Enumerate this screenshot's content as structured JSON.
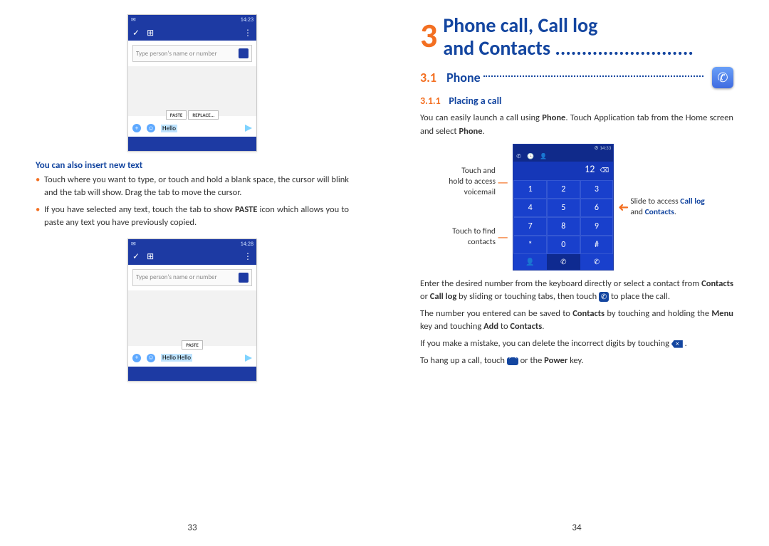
{
  "left": {
    "screenshot1": {
      "status_time": "14:23",
      "placeholder": "Type person's name or number",
      "paste": "PASTE",
      "replace": "REPLACE...",
      "selected_text": "Hello"
    },
    "heading1": "You can also insert new text",
    "bullets": [
      "Touch where you want to type, or touch and hold a blank space, the cursor will blink and the tab will show. Drag the tab to move the cursor.",
      "If you have selected any text, touch the tab to show PASTE icon which allows you to paste any text you have previously copied."
    ],
    "screenshot2": {
      "status_time": "14:28",
      "placeholder": "Type person's name or number",
      "paste": "PASTE",
      "text": "Hello Hello"
    },
    "page_num": "33"
  },
  "right": {
    "chapter_num": "3",
    "chapter_title_l1": "Phone call, Call log",
    "chapter_title_l2": "and Contacts",
    "section_num": "3.1",
    "section_title": "Phone",
    "subsection_num": "3.1.1",
    "subsection_title": "Placing a call",
    "para1_a": "You can easily launch a call using ",
    "para1_b": "Phone",
    "para1_c": ". Touch Application tab from the Home screen and select ",
    "para1_d": "Phone",
    "para1_e": ".",
    "annot_left_1": "Touch and hold to access voicemail",
    "annot_left_2": "Touch to find contacts",
    "annot_right_a": "Slide to access ",
    "annot_right_b": "Call log",
    "annot_right_c": " and ",
    "annot_right_d": "Contacts",
    "annot_right_e": ".",
    "dialer_display": "12",
    "para2_a": "Enter the desired number from the keyboard directly or select a contact from ",
    "para2_b": "Contacts",
    "para2_c": " or ",
    "para2_d": "Call log",
    "para2_e": " by sliding or touching tabs, then touch ",
    "para2_f": " to place the call.",
    "para3_a": "The number you entered can be saved to ",
    "para3_b": "Contacts",
    "para3_c": " by touching and holding the ",
    "para3_d": "Menu",
    "para3_e": " key and touching ",
    "para3_f": "Add",
    "para3_g": " to ",
    "para3_h": "Contacts",
    "para3_i": ".",
    "para4": "If you make a mistake, you can delete the incorrect digits by touching ",
    "para5_a": "To hang up a call, touch ",
    "para5_b": " or the ",
    "para5_c": "Power",
    "para5_d": " key.",
    "page_num": "34"
  }
}
